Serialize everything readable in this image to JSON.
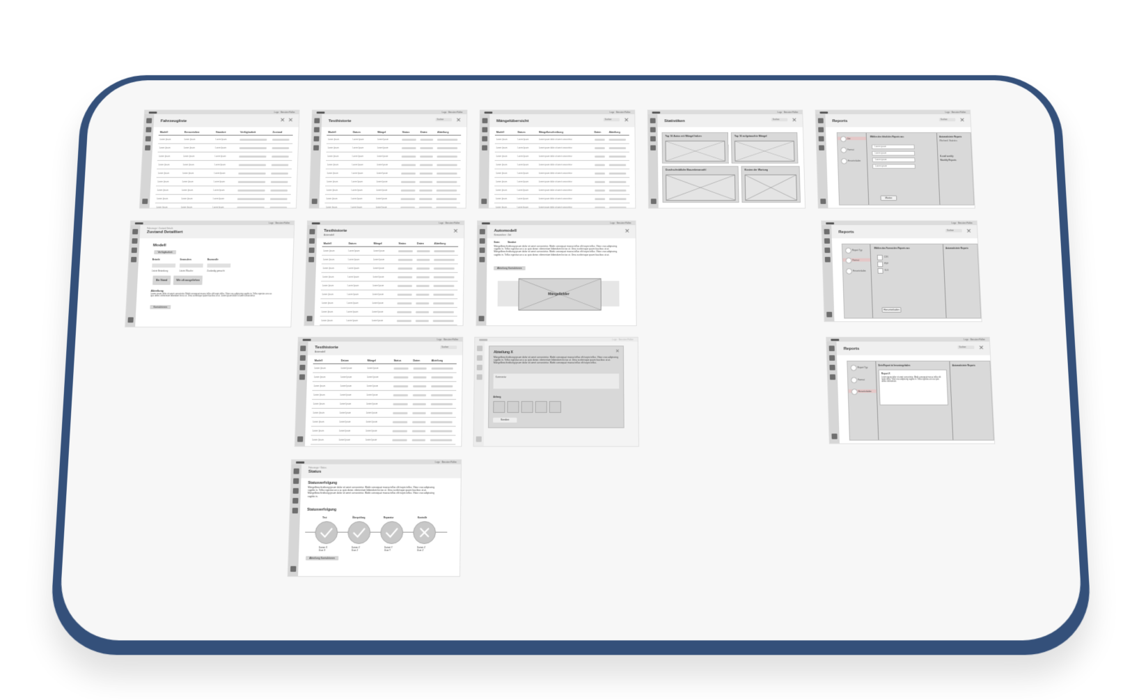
{
  "frames": {
    "fahrzeuge": {
      "topbar": "Logo · Benutzer Rollen",
      "title": "Fahrzeugliste",
      "columns": [
        "Modell",
        "Kennzeichen",
        "Standort",
        "Verfügbarkeit",
        "Zustand"
      ],
      "cell": "Lorem Ipsum"
    },
    "testhistorie1": {
      "topbar": "Logo · Benutzer Rollen",
      "title": "Testhistorie",
      "search": "Suchen",
      "columns": [
        "Modell",
        "Datum",
        "Mängel",
        "Status",
        "Daten",
        "Abteilung"
      ],
      "cell": "Lorem Ipsum"
    },
    "maengel": {
      "topbar": "Logo · Benutzer Rollen",
      "title": "Mängelübersicht",
      "search": "Suchen",
      "columns": [
        "Modell",
        "Datum",
        "Mängelbeschreibung",
        "Daten",
        "Abteilung"
      ],
      "cell": "Lorem Ipsum",
      "desc_cell": "Lorem ipsum dolor sit amet consectetur"
    },
    "statistiken": {
      "topbar": "Logo · Benutzer Rollen",
      "title": "Statistiken",
      "search": "Suchen",
      "panels": [
        "Top 10 Autos mit Mängel haben",
        "Top 10 aufgetauchte Mängel",
        "Durchschnittliche Bauzeitenanzahl",
        "Kosten der Wartung"
      ]
    },
    "reports1": {
      "topbar": "Logo · Benutzer Rollen",
      "title": "Reports",
      "search": "Suchen",
      "steps": [
        "Zeit",
        "Format",
        "Herunterladen"
      ],
      "question": "Wählen den Inhalt des Reports aus",
      "dropdown": "Lorem ipsum",
      "side_title": "Automatisierte Reports",
      "side_items": [
        "Wöchentl. Statistics",
        "E-mail weekly",
        "Monthly Reports"
      ],
      "button": "Weiter"
    },
    "zustand": {
      "topbar": "Logo · Benutzer Rollen",
      "breadcrumb": "Fahrzeuge › Zustand Details",
      "title": "Zustand Detailliert",
      "modell_label": "Modell",
      "modell_value": "Verfügbarkeit",
      "fields": [
        "Betankt",
        "Gewaschen",
        "Baumwolle"
      ],
      "sublabels": [
        "Letzte Betankung",
        "Letzte Wäsche",
        "Zuständig gemacht"
      ],
      "buttons": [
        "Ein Stand",
        "Wie oft ausgeliehen"
      ],
      "section": "Abteilung",
      "paragraph": "Lorem ipsum dolor sit amet consectetur. Morbi consequat massa tellus elit turpis tellus. Vitae cras adipiscing sagittis in. Tellus egestas arcu ac quis donec elementum bibendum lectus ut. Urna scelerisque quam faucibus at at. Lorem ipsum dolor sit amet consectetur.",
      "link_button": "Kontaktieren"
    },
    "testhistorie2": {
      "topbar": "Logo · Benutzer Rollen",
      "title": "Testhistorie",
      "subtitle": "Automodell",
      "columns": [
        "Modell",
        "Datum",
        "Mängel",
        "Status",
        "Daten",
        "Abteilung"
      ],
      "cell": "Lorem Ipsum"
    },
    "automodell": {
      "topbar": "Logo · Benutzer Rollen",
      "title": "Automodell",
      "subtitle": "Kennzeichen · Zeit",
      "labels": [
        "Daten",
        "Standort"
      ],
      "paragraph": "Mängelbeschreibung ipsum dolor sit amet consectetur. Morbi consequat massa tellus elit turpis tellus. Vitae cras adipiscing sagittis in. Tellus egestas arcu ac quis donec elementum bibendum lectus ut. Urna scelerisque quam faucibus at at. Mängelbeschreibung ipsum dolor sit amet consectetur. Morbi consequat massa tellus elit turpis tellus. Vitae cras adipiscing sagittis in. Tellus egestas arcu ac quis donec elementum bibendum lectus ut. Urna scelerisque quam faucibus at at.",
      "button": "Abteilung Kontaktieren",
      "image_label": "Mängelbilder"
    },
    "reports2": {
      "topbar": "Logo · Benutzer Rollen",
      "title": "Reports",
      "search": "Suchen",
      "steps": [
        "Report Typ",
        "Format",
        "Herunterladen"
      ],
      "question": "Wählen das Format des Reports aus",
      "options": [
        "CSV",
        "PDF",
        "XLS"
      ],
      "side_title": "Automatisierte Reports",
      "button": "Herunterladen"
    },
    "testhistorie3": {
      "topbar": "Logo · Benutzer Rollen",
      "title": "Testhistorie",
      "subtitle": "Automodell",
      "search": "Suchen",
      "columns": [
        "Modell",
        "Datum",
        "Mängel",
        "Status",
        "Daten",
        "Abteilung"
      ],
      "cell": "Lorem Ipsum"
    },
    "abteilung": {
      "topbar": "Logo · Benutzer Rollen",
      "title": "Abteilung X",
      "paragraph": "Mängelbeschreibung ipsum dolor sit amet consectetur. Morbi consequat massa tellus elit turpis tellus. Vitae cras adipiscing sagittis in. Tellus egestas arcu ac quis donec elementum bibendum lectus ut. Urna scelerisque quam faucibus at at. Mängelbeschreibung ipsum dolor sit amet consectetur. Morbi consequat massa tellus elit turpis tellus.",
      "comment_label": "Kommentar",
      "attach_label": "Anhang",
      "button": "Senden"
    },
    "reports3": {
      "topbar": "Logo · Benutzer Rollen",
      "title": "Reports",
      "search": "Suchen",
      "steps": [
        "Report Typ",
        "Format",
        "Herunterladen"
      ],
      "preview_title": "Dein Report ist heruntergeladen",
      "card_title": "Report X",
      "side_title": "Automatisierte Reports",
      "card_text": "Lorem ipsum dolor sit amet consectetur. Morbi consequat massa tellus elit turpis tellus. Vitae cras adipiscing sagittis in. Tellus egestas arcu ac quis donec elementum."
    },
    "status": {
      "topbar": "Logo · Benutzer Rollen",
      "breadcrumb": "Fahrzeuge › Status",
      "title": "Status",
      "heading1": "Statusverfolgung",
      "paragraph": "Mängelbeschreibung ipsum dolor sit amet consectetur. Morbi consequat massa tellus elit turpis tellus. Vitae cras adipiscing sagittis in. Tellus egestas arcu ac quis donec elementum bibendum lectus ut. Urna scelerisque quam faucibus at at. Mängelbeschreibung ipsum dolor sit amet consectetur. Morbi consequat massa tellus elit turpis tellus. Vitae cras adipiscing sagittis in.",
      "heading2": "Statusverfolgung",
      "steps": [
        {
          "label": "Test",
          "date": "Datum X",
          "user": "User X",
          "done": true
        },
        {
          "label": "Überprüfung",
          "date": "Datum Z",
          "user": "User Z",
          "done": true
        },
        {
          "label": "Reparatur",
          "date": "Datum Y",
          "user": "User Y",
          "done": true
        },
        {
          "label": "Kontrolle",
          "date": "Datum Z",
          "user": "User Z",
          "done": false
        }
      ],
      "button": "Abteilung Kontaktieren"
    }
  }
}
